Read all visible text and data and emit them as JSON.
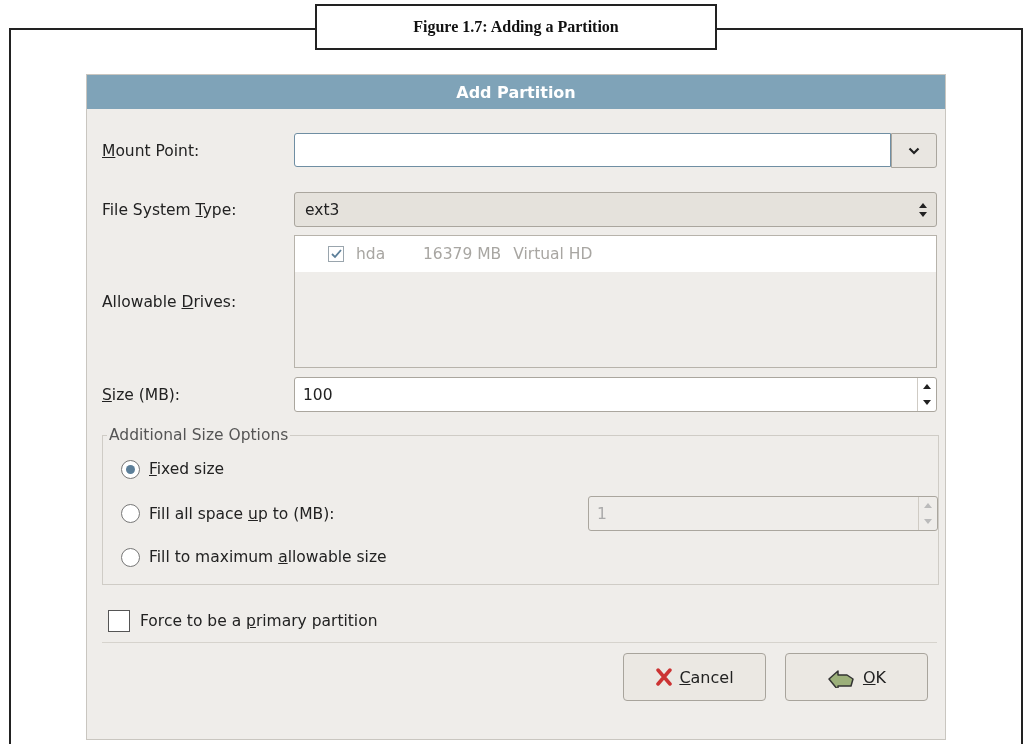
{
  "caption": "Figure 1.7: Adding a Partition",
  "dialog": {
    "title": "Add Partition",
    "mount_point": {
      "label": [
        {
          "text": "M",
          "underlined": true
        },
        {
          "text": "ount Point:",
          "underlined": false
        }
      ]
    },
    "file_system_type": {
      "label": [
        {
          "text": "File System ",
          "underlined": false
        },
        {
          "text": "T",
          "underlined": true
        },
        {
          "text": "ype:",
          "underlined": false
        }
      ],
      "value": "ext3"
    },
    "allowable_drives": {
      "label": [
        {
          "text": "Allowable ",
          "underlined": false
        },
        {
          "text": "D",
          "underlined": true
        },
        {
          "text": "rives:",
          "underlined": false
        }
      ],
      "rows": [
        {
          "checked": true,
          "drive": "hda",
          "size": "16379 MB",
          "model": "Virtual HD"
        }
      ]
    },
    "size": {
      "label": [
        {
          "text": "S",
          "underlined": true
        },
        {
          "text": "ize (MB):",
          "underlined": false
        }
      ],
      "value": "100"
    },
    "size_options": {
      "title": "Additional Size Options",
      "options": [
        {
          "label": [
            {
              "text": "F",
              "underlined": true
            },
            {
              "text": "ixed size",
              "underlined": false
            }
          ],
          "selected": true
        },
        {
          "label": [
            {
              "text": "Fill all space ",
              "underlined": false
            },
            {
              "text": "u",
              "underlined": true
            },
            {
              "text": "p to (MB):",
              "underlined": false
            }
          ],
          "selected": false,
          "spin_value": "1",
          "spin_disabled": true
        },
        {
          "label": [
            {
              "text": "Fill to maximum ",
              "underlined": false
            },
            {
              "text": "a",
              "underlined": true
            },
            {
              "text": "llowable size",
              "underlined": false
            }
          ],
          "selected": false
        }
      ]
    },
    "force_primary": {
      "label": [
        {
          "text": "Force to be a ",
          "underlined": false
        },
        {
          "text": "p",
          "underlined": true
        },
        {
          "text": "rimary partition",
          "underlined": false
        }
      ],
      "checked": false
    },
    "buttons": [
      {
        "kind": "cancel",
        "label": [
          {
            "text": "C",
            "underlined": true
          },
          {
            "text": "ancel",
            "underlined": false
          }
        ]
      },
      {
        "kind": "ok",
        "label": [
          {
            "text": "O",
            "underlined": true
          },
          {
            "text": "K",
            "underlined": false
          }
        ]
      }
    ]
  }
}
